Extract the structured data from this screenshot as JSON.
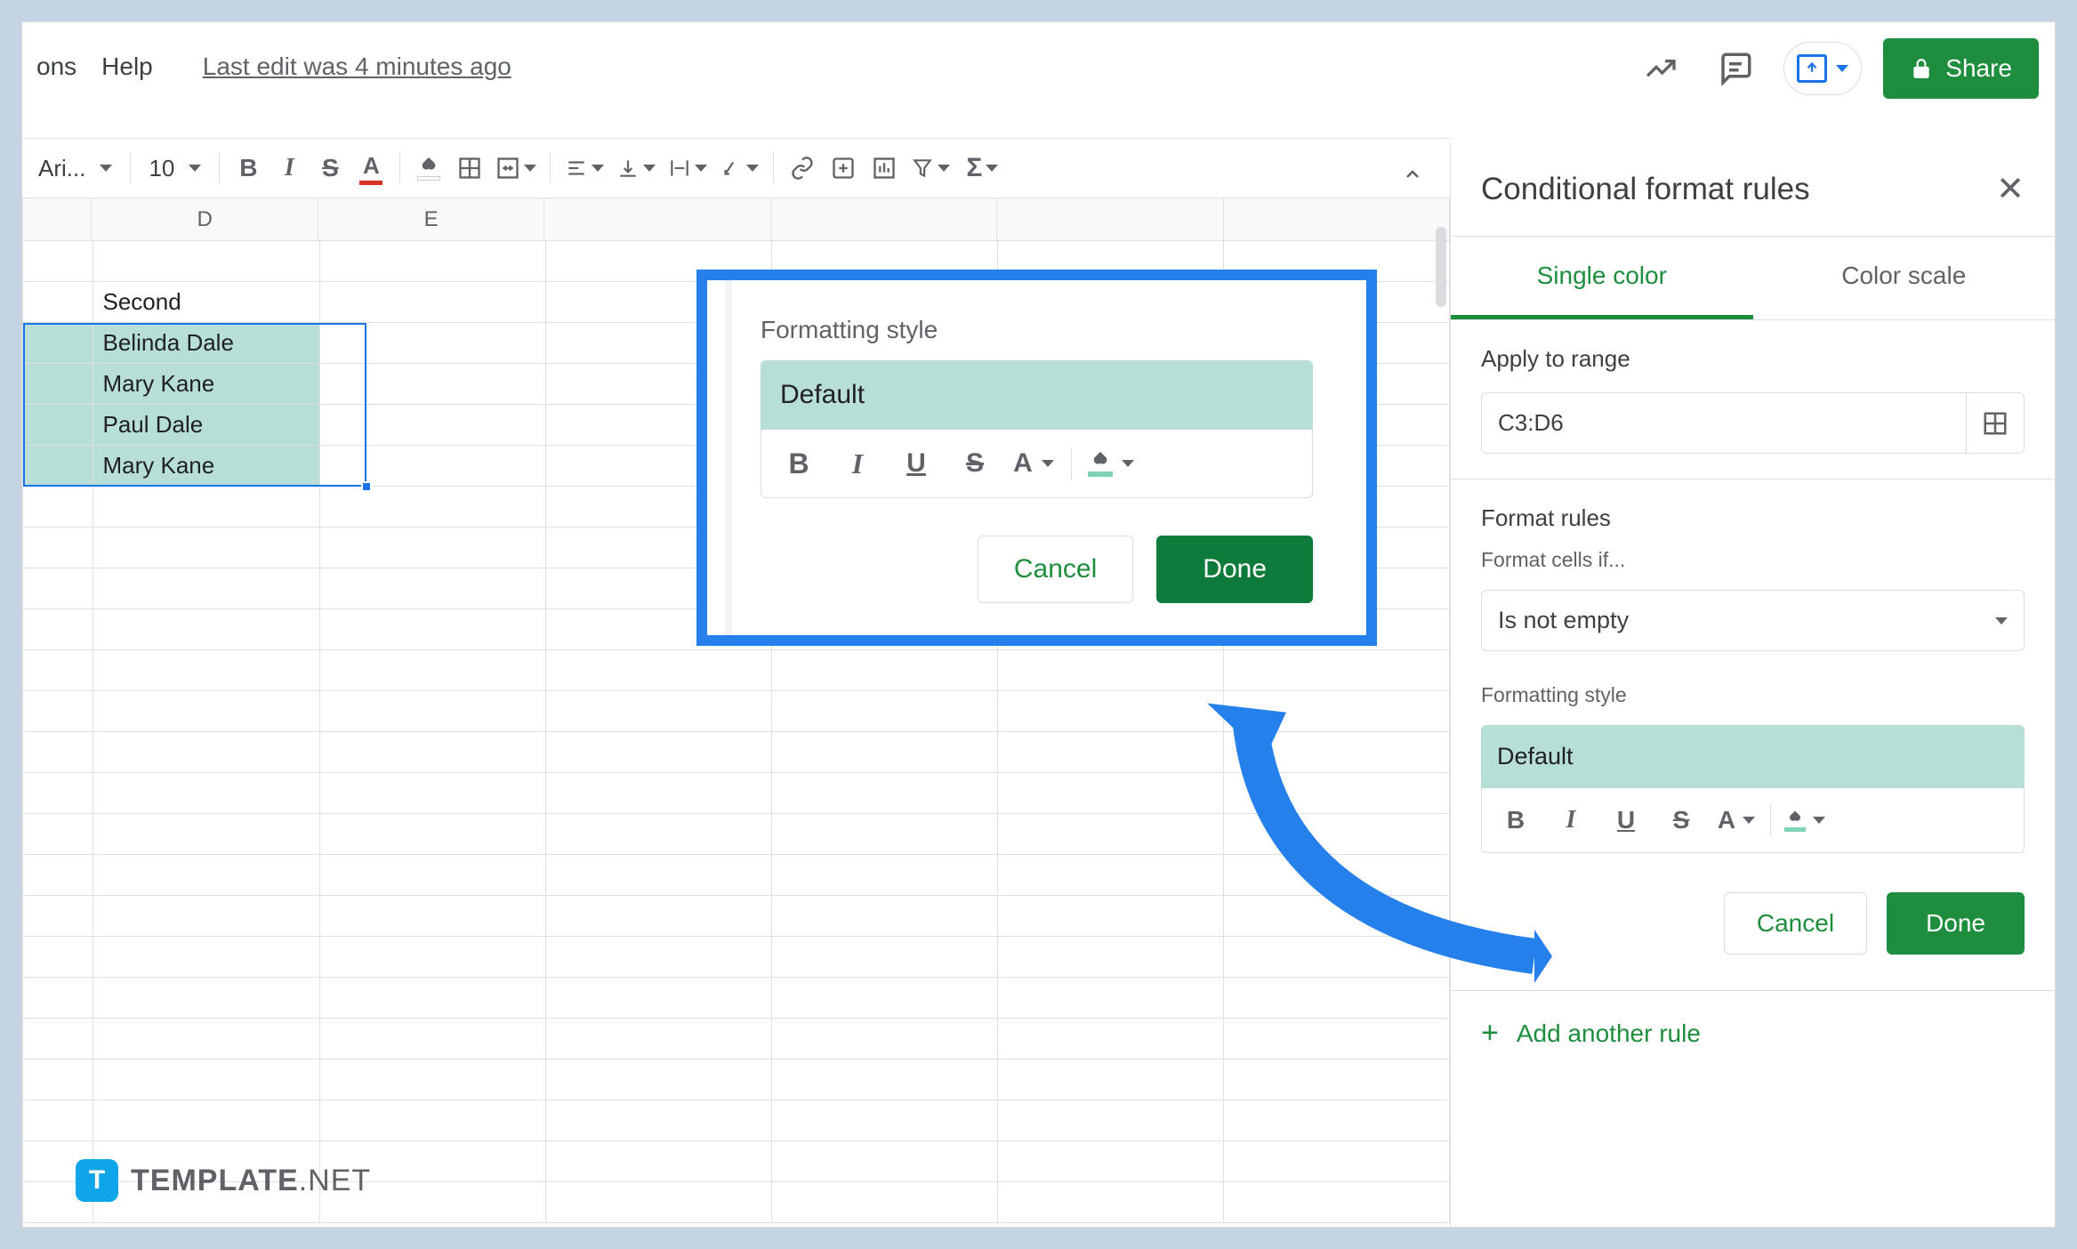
{
  "menu": {
    "items": [
      "ons",
      "Help"
    ],
    "last_edit": "Last edit was 4 minutes ago"
  },
  "header_right": {
    "share": "Share"
  },
  "toolbar": {
    "font_name": "Ari...",
    "font_size": "10"
  },
  "columns": [
    "D",
    "E"
  ],
  "cells": {
    "header": "Second",
    "rows": [
      "Belinda Dale",
      "Mary Kane",
      "Paul Dale",
      "Mary Kane"
    ]
  },
  "sidebar": {
    "title": "Conditional format rules",
    "tabs": {
      "single": "Single color",
      "scale": "Color scale"
    },
    "apply_label": "Apply to range",
    "range": "C3:D6",
    "format_rules_label": "Format rules",
    "format_if_label": "Format cells if...",
    "format_if_value": "Is not empty",
    "fmt_style_label": "Formatting style",
    "default_label": "Default",
    "cancel": "Cancel",
    "done": "Done",
    "add_rule": "Add another rule"
  },
  "callout": {
    "fmt_style_label": "Formatting style",
    "default_label": "Default",
    "cancel": "Cancel",
    "done": "Done"
  },
  "watermark": {
    "badge": "T",
    "name": "TEMPLATE",
    "suffix": ".NET"
  }
}
